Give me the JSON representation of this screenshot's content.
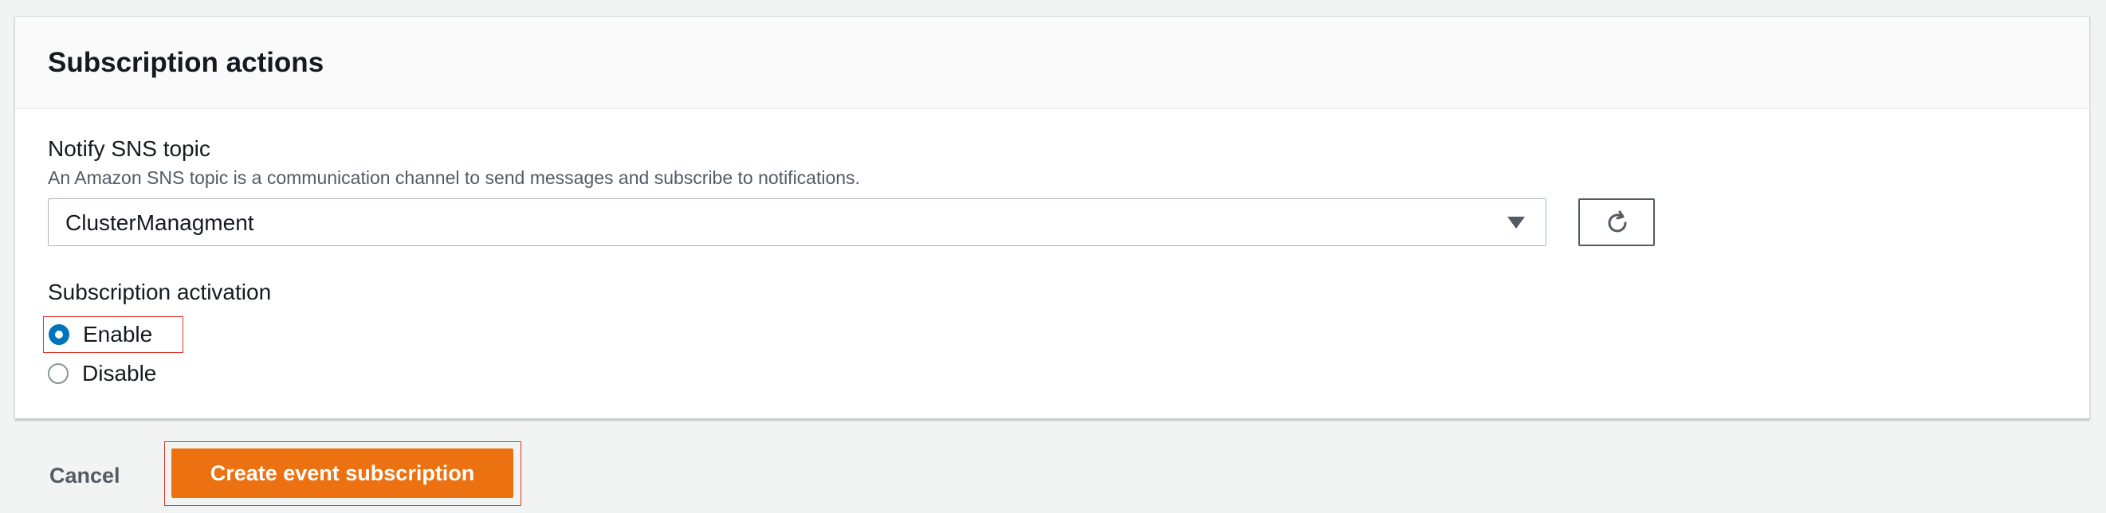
{
  "panel": {
    "title": "Subscription actions"
  },
  "sns_topic": {
    "label": "Notify SNS topic",
    "description": "An Amazon SNS topic is a communication channel to send messages and subscribe to notifications.",
    "selected_value": "ClusterManagment",
    "caret_icon": "caret-down-icon",
    "refresh_icon": "refresh-icon"
  },
  "activation": {
    "label": "Subscription activation",
    "options": [
      {
        "label": "Enable",
        "checked": true
      },
      {
        "label": "Disable",
        "checked": false
      }
    ]
  },
  "footer": {
    "cancel_label": "Cancel",
    "create_label": "Create event subscription"
  },
  "colors": {
    "primary": "#ec7211",
    "radio_checked": "#0073bb",
    "highlight_outline": "#e0342a",
    "background": "#f2f3f3"
  }
}
